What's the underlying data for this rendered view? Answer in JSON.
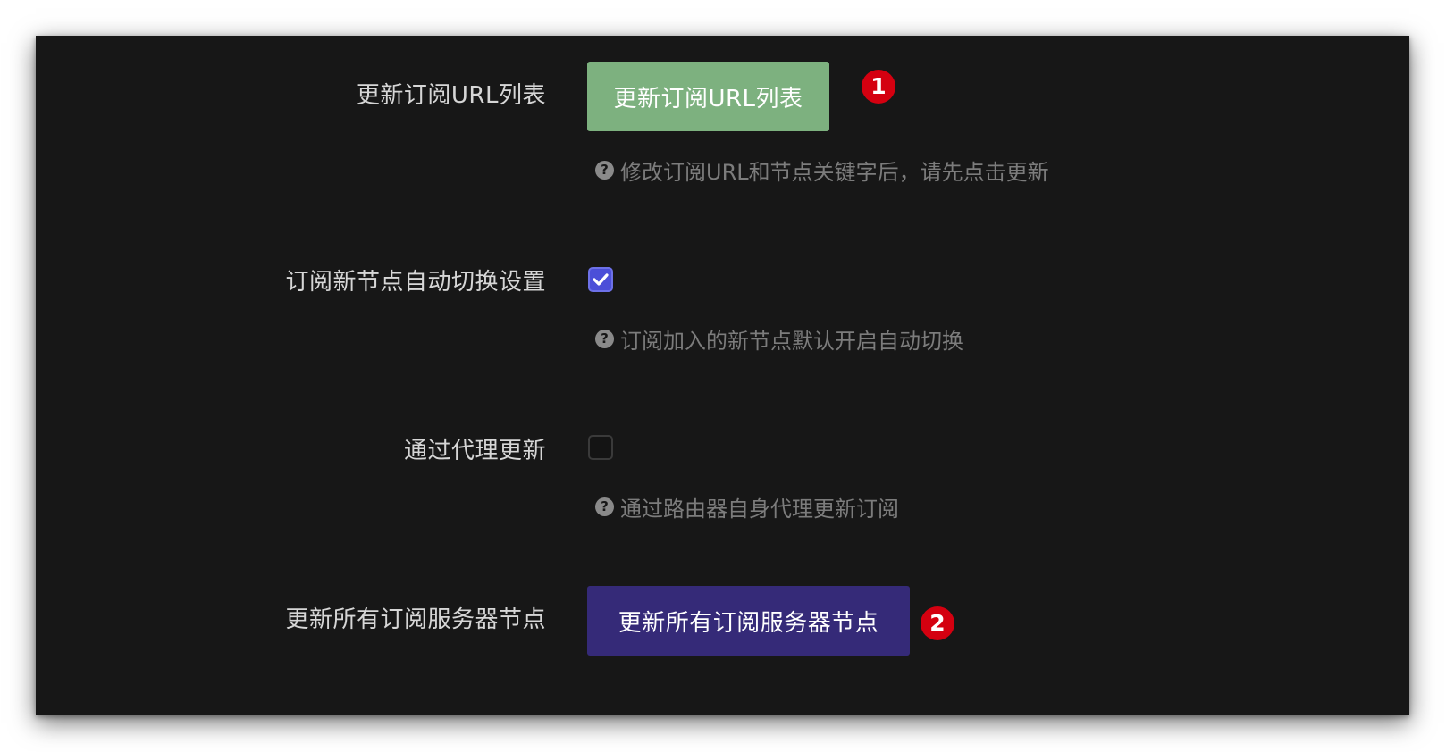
{
  "rows": [
    {
      "label": "更新订阅URL列表",
      "button_label": "更新订阅URL列表",
      "hint": "修改订阅URL和节点关键字后，请先点击更新",
      "marker": "1"
    },
    {
      "label": "订阅新节点自动切换设置",
      "checked": true,
      "hint": "订阅加入的新节点默认开启自动切换"
    },
    {
      "label": "通过代理更新",
      "checked": false,
      "hint": "通过路由器自身代理更新订阅"
    },
    {
      "label": "更新所有订阅服务器节点",
      "button_label": "更新所有订阅服务器节点",
      "marker": "2"
    }
  ],
  "icons": {
    "hint": "question-circle-icon",
    "check": "checkmark-icon"
  },
  "colors": {
    "panel_bg": "#171717",
    "update_url_button": "#7db17f",
    "update_nodes_button": "#352a78",
    "checkbox_checked": "#4b4fd8",
    "marker": "#d40010"
  }
}
